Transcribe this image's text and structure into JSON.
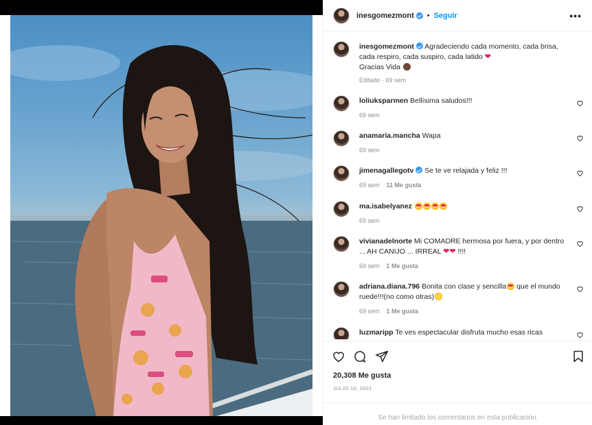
{
  "header": {
    "username": "inesgomezmont",
    "follow_label": "Seguir",
    "dot": "•",
    "more_label": "•••"
  },
  "caption": {
    "username": "inesgomezmont",
    "text_line1": "Agradeciendo cada momento, cada brisa,",
    "text_line2": "cada respiro, cada suspiro, cada latido",
    "text_line3": "Gracias Vida",
    "edited": "Editado",
    "time": "69 sem"
  },
  "comments": [
    {
      "username": "loliuksparmen",
      "text": "Bellísima saludos!!!",
      "time": "69 sem",
      "likes": ""
    },
    {
      "username": "anamaria.mancha",
      "text": "Wapa",
      "time": "69 sem",
      "likes": ""
    },
    {
      "username": "jimenagallegotv",
      "text": "Se te ve relajada y feliz !!!",
      "time": "69 sem",
      "likes": "11 Me gusta"
    },
    {
      "username": "ma.isabelyanez",
      "text": "",
      "time": "69 sem",
      "likes": ""
    },
    {
      "username": "vivianadelnorte",
      "text_line1": "Mi COMADRE hermosa por fuera, y por dentro",
      "text_line2": "... AH CANIJO ... IRREAL",
      "text_end": "!!!!",
      "time": "69 sem",
      "likes": "1 Me gusta"
    },
    {
      "username": "adriana.diana.796",
      "text_line1": "Bonita con clase y sencilla",
      "text_mid": "que el mundo",
      "text_line2": "ruede!!!(no como otras)",
      "time": "69 sem",
      "likes": "1 Me gusta"
    },
    {
      "username": "luzmaripp",
      "text": "Te ves espectacular disfruta mucho esas ricas",
      "time": "",
      "likes": ""
    }
  ],
  "actions": {
    "likes_total": "20,308 Me gusta",
    "date": "JULIO 10, 2021"
  },
  "footer": {
    "text": "Se han limitado los comentarios en esta publicación."
  },
  "colors": {
    "accent": "#0095f6",
    "verified": "#3897f0",
    "heart": "#e0245e"
  }
}
